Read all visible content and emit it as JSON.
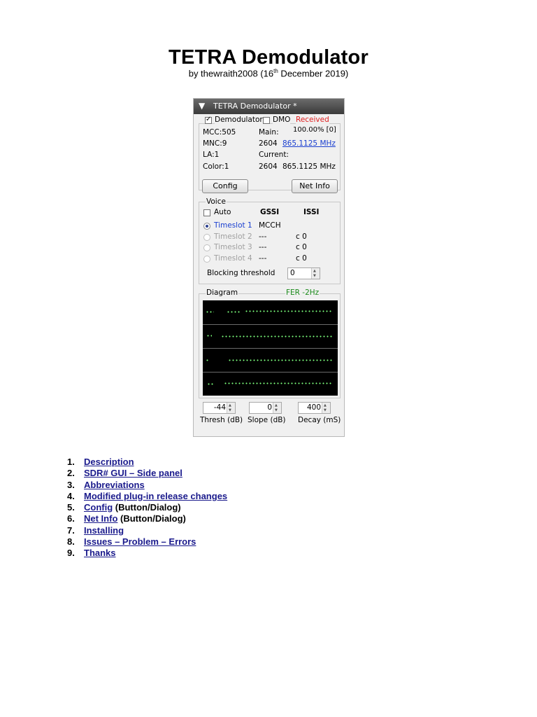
{
  "doc": {
    "title": "TETRA Demodulator",
    "subtitle_prefix": "by thewraith2008 (16",
    "subtitle_sup": "th",
    "subtitle_suffix": " December 2019)"
  },
  "panel": {
    "header_arrow": "▼",
    "header_title": "TETRA Demodulator *",
    "demodulator_label": "Demodulator",
    "demodulator_checked": true,
    "dmo_label": "DMO",
    "dmo_checked": false,
    "status": "Received",
    "status_color": "#e02020",
    "mcc": "MCC:505",
    "mnc": "MNC:9",
    "la": "LA:1",
    "color": "Color:1",
    "main_label": "Main:",
    "main_percent": "100.00% [0]",
    "main_channel": "2604",
    "main_freq": "865.1125 MHz",
    "current_label": "Current:",
    "current_channel": "2604",
    "current_freq": "865.1125 MHz",
    "config_button": "Config",
    "netinfo_button": "Net Info",
    "voice": {
      "group_label": "Voice",
      "auto_label": "Auto",
      "gssi_header": "GSSI",
      "issi_header": "ISSI",
      "timeslots": [
        {
          "label": "Timeslot 1",
          "gssi": "MCCH",
          "issi": "",
          "selected": true
        },
        {
          "label": "Timeslot 2",
          "gssi": "---",
          "issi": "c 0",
          "selected": false
        },
        {
          "label": "Timeslot 3",
          "gssi": "---",
          "issi": "c 0",
          "selected": false
        },
        {
          "label": "Timeslot 4",
          "gssi": "---",
          "issi": "c 0",
          "selected": false
        }
      ],
      "blocking_label": "Blocking threshold",
      "blocking_value": "0"
    },
    "diagram": {
      "group_label": "Diagram",
      "fer_label": "FER -2Hz",
      "fer_color": "#1a8a1a"
    },
    "controls": {
      "thresh_value": "-44",
      "thresh_label": "Thresh (dB)",
      "slope_value": "0",
      "slope_label": "Slope (dB)",
      "decay_value": "400",
      "decay_label": "Decay (mS)"
    }
  },
  "toc": [
    {
      "num": "1.",
      "link": "Description",
      "rest": ""
    },
    {
      "num": "2.",
      "link": "SDR# GUI – Side panel",
      "rest": ""
    },
    {
      "num": "3.",
      "link": "Abbreviations",
      "rest": ""
    },
    {
      "num": "4.",
      "link": "Modified plug-in release changes",
      "rest": ""
    },
    {
      "num": "5.",
      "link": "Config",
      "rest": " (Button/Dialog)"
    },
    {
      "num": "6.",
      "link": "Net Info",
      "rest": " (Button/Dialog)"
    },
    {
      "num": "7.",
      "link": "Installing",
      "rest": ""
    },
    {
      "num": "8.",
      "link": "Issues – Problem – Errors",
      "rest": ""
    },
    {
      "num": "9.",
      "link": "Thanks",
      "rest": ""
    }
  ]
}
